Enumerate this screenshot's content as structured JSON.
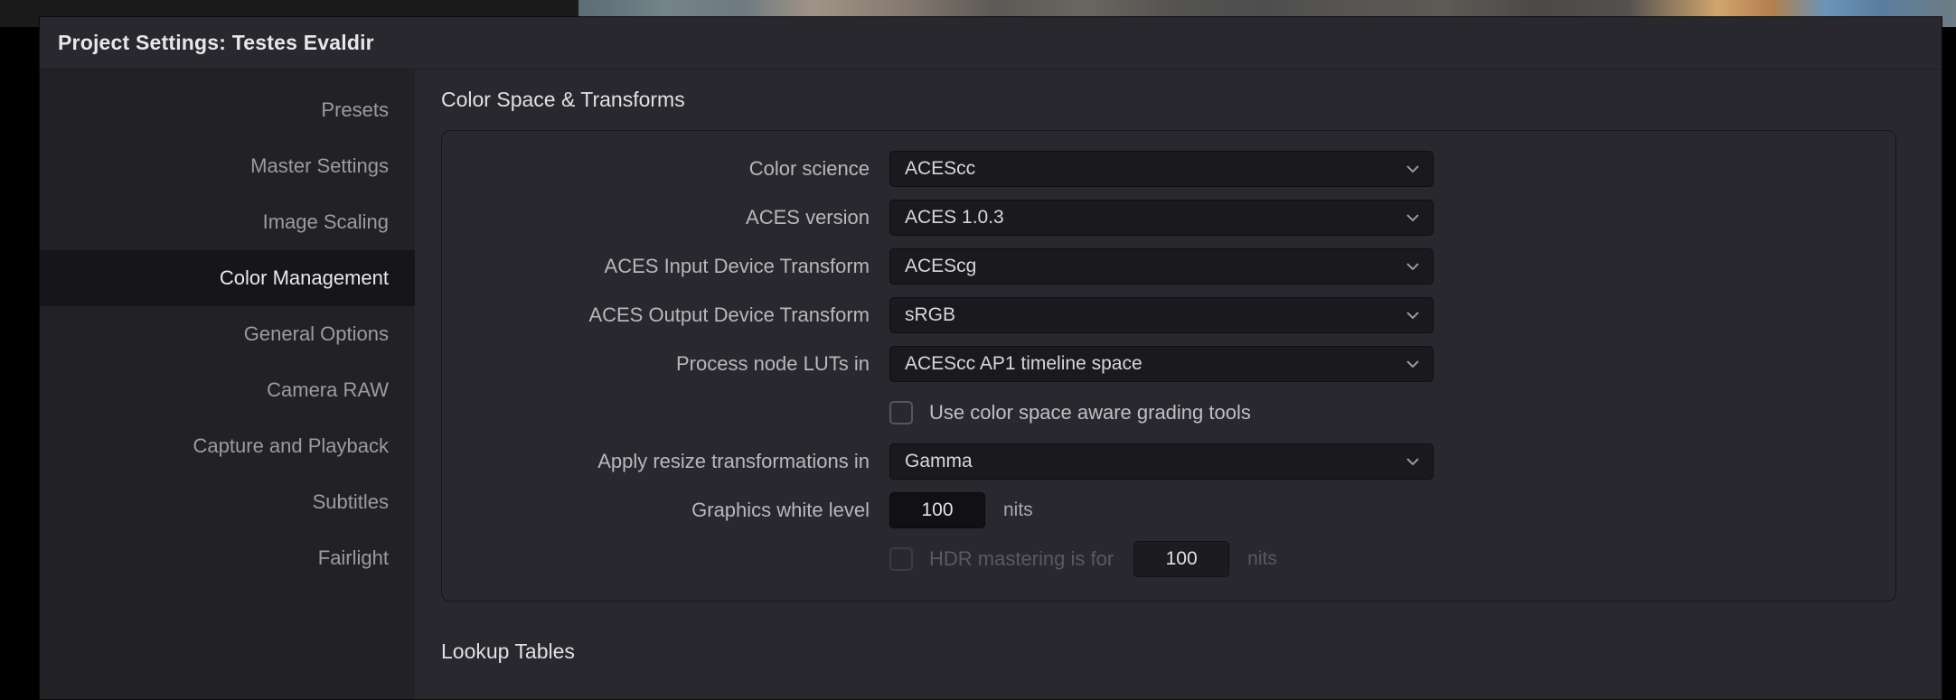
{
  "window": {
    "title": "Project Settings:  Testes Evaldir"
  },
  "sidebar": {
    "items": [
      {
        "label": "Presets"
      },
      {
        "label": "Master Settings"
      },
      {
        "label": "Image Scaling"
      },
      {
        "label": "Color Management"
      },
      {
        "label": "General Options"
      },
      {
        "label": "Camera RAW"
      },
      {
        "label": "Capture and Playback"
      },
      {
        "label": "Subtitles"
      },
      {
        "label": "Fairlight"
      }
    ],
    "active_index": 3
  },
  "sections": {
    "color_space_title": "Color Space & Transforms",
    "lookup_tables_title": "Lookup Tables"
  },
  "fields": {
    "color_science": {
      "label": "Color science",
      "value": "ACEScc"
    },
    "aces_version": {
      "label": "ACES version",
      "value": "ACES 1.0.3"
    },
    "aces_idt": {
      "label": "ACES Input Device Transform",
      "value": "ACEScg"
    },
    "aces_odt": {
      "label": "ACES Output Device Transform",
      "value": "sRGB"
    },
    "process_luts": {
      "label": "Process node LUTs in",
      "value": "ACEScc AP1 timeline space"
    },
    "color_aware": {
      "label": "Use color space aware grading tools",
      "checked": false
    },
    "resize_in": {
      "label": "Apply resize transformations in",
      "value": "Gamma"
    },
    "gfx_white": {
      "label": "Graphics white level",
      "value": "100",
      "unit": "nits"
    },
    "hdr_master": {
      "label": "HDR mastering is for",
      "value": "100",
      "unit": "nits",
      "enabled": false
    }
  }
}
